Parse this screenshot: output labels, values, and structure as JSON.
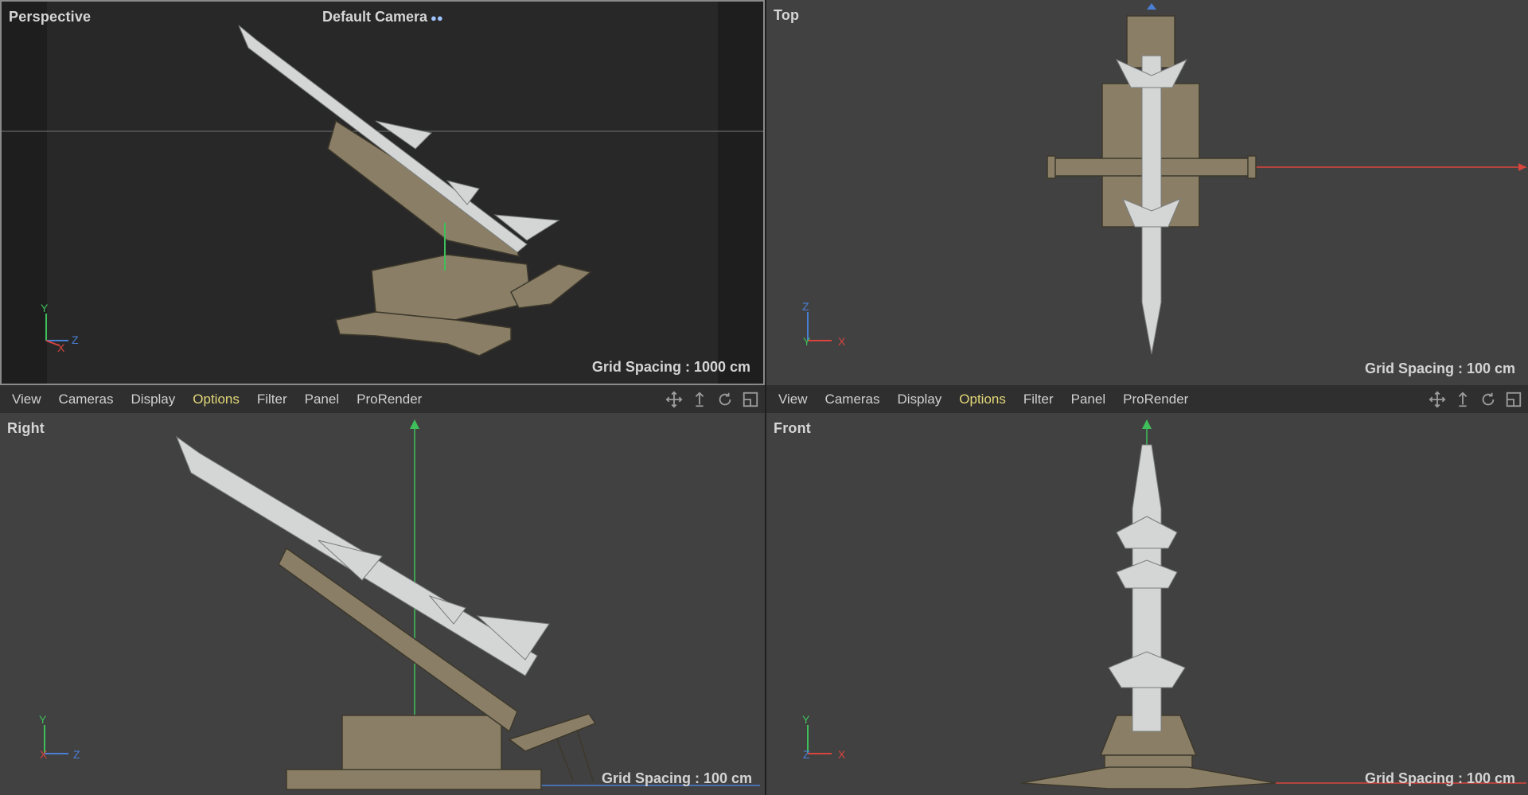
{
  "viewports": {
    "perspective": {
      "title": "Perspective",
      "camera": "Default Camera",
      "grid_spacing": "Grid Spacing : 1000 cm",
      "axes": [
        "Y",
        "X",
        "Z"
      ]
    },
    "top": {
      "title": "Top",
      "grid_spacing": "Grid Spacing : 100 cm",
      "axes": [
        "Z",
        "Y",
        "X"
      ]
    },
    "right": {
      "title": "Right",
      "grid_spacing": "Grid Spacing : 100 cm",
      "axes": [
        "Y",
        "X",
        "Z"
      ]
    },
    "front": {
      "title": "Front",
      "grid_spacing": "Grid Spacing : 100 cm",
      "axes": [
        "Y",
        "Z",
        "X"
      ]
    }
  },
  "menu": {
    "items": [
      "View",
      "Cameras",
      "Display",
      "Options",
      "Filter",
      "Panel",
      "ProRender"
    ],
    "active": "Options"
  },
  "nav_icons": [
    "move-icon",
    "dolly-icon",
    "rotate-icon",
    "maximize-icon"
  ],
  "colors": {
    "axis_x": "#d9453d",
    "axis_y": "#3fbf5a",
    "axis_z": "#4a7fd6",
    "active_menu": "#e3d879",
    "viewport_bg": "#414141",
    "perspective_bg": "#282828"
  }
}
